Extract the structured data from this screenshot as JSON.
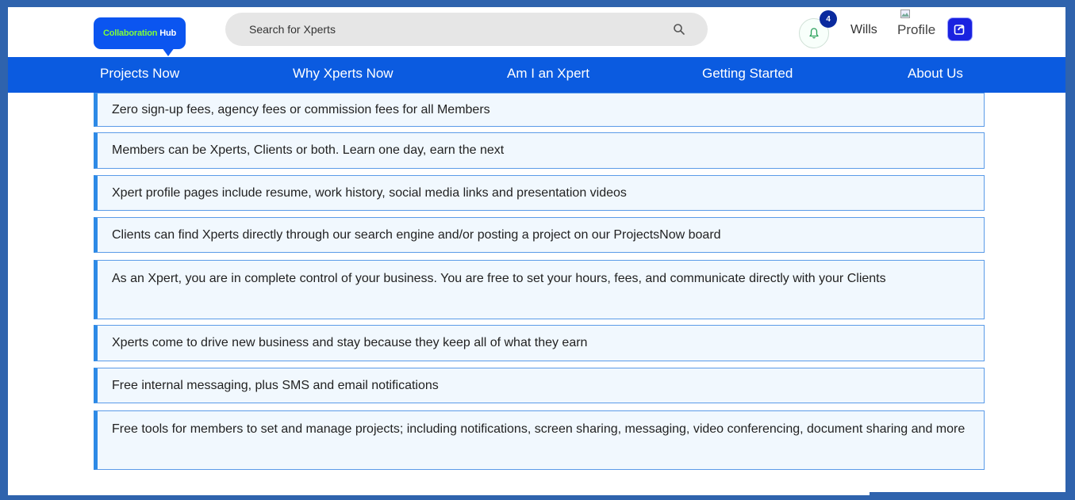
{
  "header": {
    "logo_primary": "Collaboration",
    "logo_secondary": "Hub",
    "search_placeholder": "Search for Xperts",
    "notification_count": "4",
    "username": "Wills",
    "profile_alt": "Profile"
  },
  "nav": {
    "items": [
      {
        "label": "Projects Now"
      },
      {
        "label": "Why Xperts Now"
      },
      {
        "label": "Am I an Xpert"
      },
      {
        "label": "Getting Started"
      },
      {
        "label": "About Us"
      }
    ]
  },
  "features": [
    {
      "text": "Zero sign-up fees, agency fees or commission fees for all Members"
    },
    {
      "text": "Members can be Xperts, Clients or both. Learn one day, earn the next"
    },
    {
      "text": "Xpert profile pages include resume, work history, social media links and presentation videos"
    },
    {
      "text": "Clients can find Xperts directly through our search engine and/or posting a project on our ProjectsNow board"
    },
    {
      "text": "As an Xpert, you are in complete control of your business. You are free to set your hours, fees, and communicate directly with your Clients"
    },
    {
      "text": "Xperts come to drive new business and stay because they keep all of what they earn"
    },
    {
      "text": "Free internal messaging, plus SMS and email notifications"
    },
    {
      "text": "Free tools for members to set and manage projects; including notifications, screen sharing, messaging, video conferencing, document sharing and more"
    }
  ],
  "colors": {
    "nav_background": "#0b5be0",
    "logo_background": "#0b55f0",
    "logo_accent": "#7dff3a",
    "feature_border": "#5b9be8",
    "feature_accent": "#2d8ae6",
    "page_border": "#2f63ad"
  },
  "icons": {
    "search": "search-icon",
    "notifications": "bell-icon",
    "profile": "broken-image-icon",
    "share": "share-icon"
  }
}
